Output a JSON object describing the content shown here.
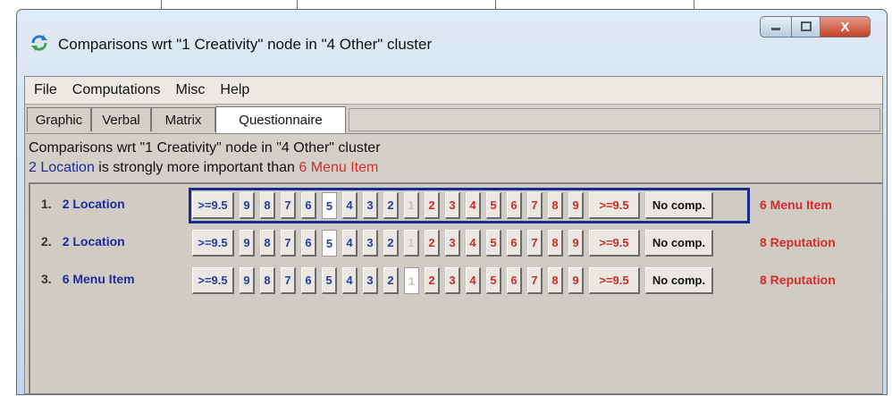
{
  "window": {
    "title": "Comparisons wrt \"1 Creativity\" node in \"4 Other\" cluster",
    "close_glyph": "X"
  },
  "menu": [
    "File",
    "Computations",
    "Misc",
    "Help"
  ],
  "tabs": [
    "Graphic",
    "Verbal",
    "Matrix",
    "Questionnaire"
  ],
  "active_tab": "Questionnaire",
  "heading": "Comparisons wrt \"1 Creativity\" node in \"4 Other\" cluster",
  "statement": {
    "left_node": "2 Location",
    "middle": " is strongly more important than ",
    "right_node": "6 Menu Item"
  },
  "scale_labels": [
    ">=9.5",
    "9",
    "8",
    "7",
    "6",
    "5",
    "4",
    "3",
    "2",
    "1",
    "2",
    "3",
    "4",
    "5",
    "6",
    "7",
    "8",
    "9",
    ">=9.5",
    "No comp."
  ],
  "comparisons": [
    {
      "number": "1.",
      "left": "2 Location",
      "right": "6 Menu Item",
      "selected_index": 5,
      "row_selected": true
    },
    {
      "number": "2.",
      "left": "2 Location",
      "right": "8 Reputation",
      "selected_index": 5,
      "row_selected": false
    },
    {
      "number": "3.",
      "left": "6 Menu Item",
      "right": "8 Reputation",
      "selected_index": 9,
      "row_selected": false
    }
  ],
  "colors": {
    "left_node": "#1e2a9c",
    "right_node": "#d52c2c",
    "selected_border": "#1a2a8f",
    "panel_bg": "#d0ccc4"
  },
  "icons": [
    "refresh-icon",
    "minimize-icon",
    "maximize-icon",
    "close-icon"
  ]
}
